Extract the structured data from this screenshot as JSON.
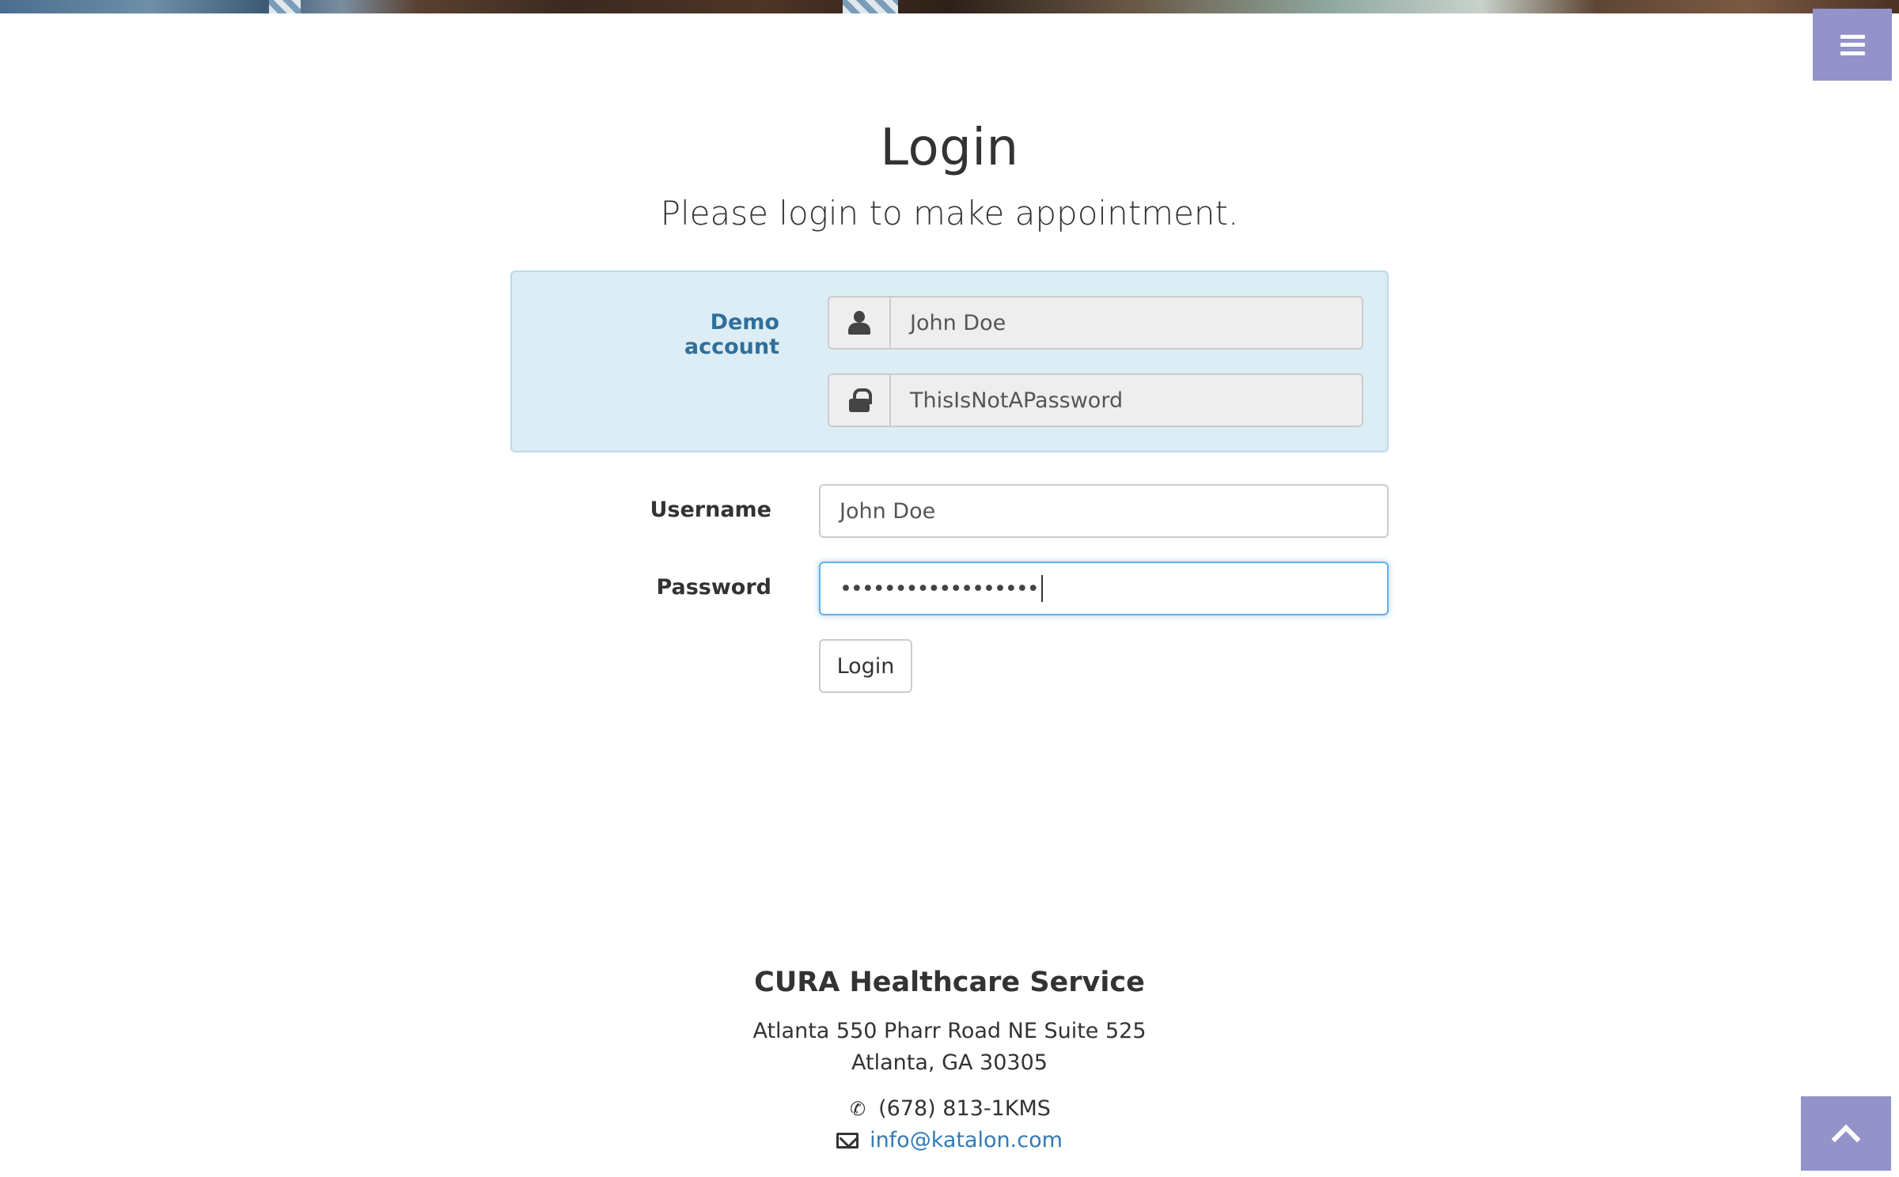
{
  "header": {
    "title": "Login",
    "subtitle": "Please login to make appointment."
  },
  "demo_account": {
    "label": "Demo account",
    "username": "John Doe",
    "password": "ThisIsNotAPassword"
  },
  "form": {
    "username_label": "Username",
    "username_value": "John Doe",
    "password_label": "Password",
    "password_masked": "••••••••••••••••••",
    "login_button": "Login"
  },
  "footer": {
    "company": "CURA Healthcare Service",
    "address_line1": "Atlanta 550 Pharr Road NE Suite 525",
    "address_line2": "Atlanta, GA 30305",
    "phone": "(678) 813-1KMS",
    "email": "info@katalon.com"
  },
  "icons": {
    "menu": "menu-icon",
    "user": "user-icon",
    "lock": "lock-icon",
    "phone": "phone-icon",
    "mail": "envelope-icon",
    "to_top": "chevron-up-icon"
  },
  "colors": {
    "accent": "#9393c9",
    "demo_panel_bg": "#dcedf5",
    "demo_label": "#2f6f9a",
    "link": "#337ab7",
    "focus_border": "#66afe9"
  }
}
